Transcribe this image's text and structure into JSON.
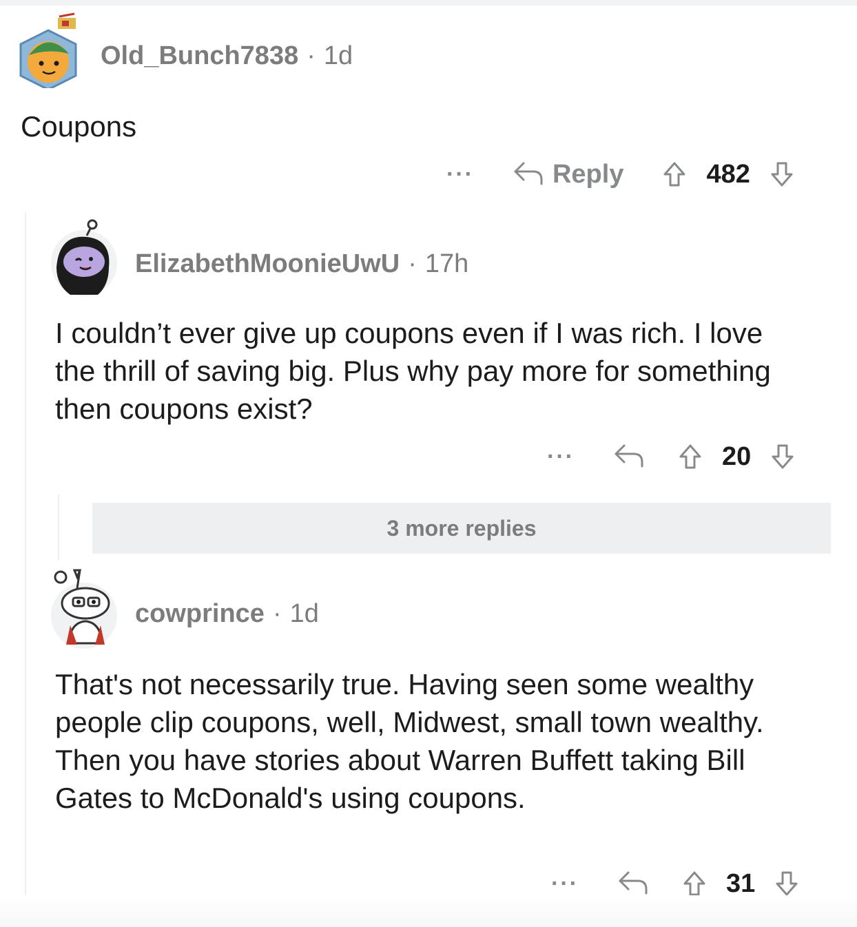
{
  "comments": [
    {
      "author": "Old_Bunch7838",
      "separator": "·",
      "time": "1d",
      "body": "Coupons",
      "actions": {
        "more": "···",
        "reply_label": "Reply",
        "votes": "482"
      }
    },
    {
      "author": "ElizabethMoonieUwU",
      "separator": "·",
      "time": "17h",
      "body": "I couldn’t ever give up coupons even if I was rich. I love the thrill of saving big. Plus why pay more for something then coupons exist?",
      "actions": {
        "more": "···",
        "votes": "20"
      },
      "more_replies": "3 more replies"
    },
    {
      "author": "cowprince",
      "separator": "·",
      "time": "1d",
      "body": "That's not necessarily true. Having seen some wealthy people clip coupons, well, Midwest, small town wealthy. Then you have stories about Warren Buffett taking Bill Gates to McDonald's using coupons.",
      "actions": {
        "more": "···",
        "votes": "31"
      }
    }
  ],
  "icons": {
    "reply": "reply-arrow-icon",
    "upvote": "upvote-arrow-icon",
    "downvote": "downvote-arrow-icon"
  }
}
